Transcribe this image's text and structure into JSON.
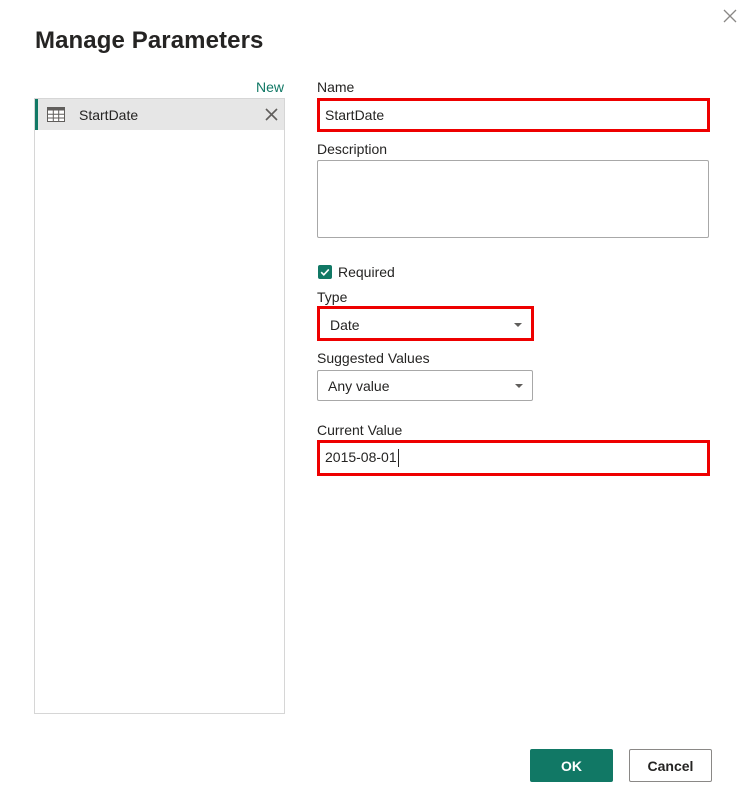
{
  "dialog": {
    "title": "Manage Parameters"
  },
  "list": {
    "new_label": "New",
    "items": [
      {
        "label": "StartDate",
        "selected": true
      }
    ]
  },
  "form": {
    "name_label": "Name",
    "name_value": "StartDate",
    "description_label": "Description",
    "description_value": "",
    "required_label": "Required",
    "required_checked": true,
    "type_label": "Type",
    "type_value": "Date",
    "suggested_label": "Suggested Values",
    "suggested_value": "Any value",
    "current_label": "Current Value",
    "current_value": "2015-08-01"
  },
  "buttons": {
    "ok": "OK",
    "cancel": "Cancel"
  },
  "colors": {
    "accent": "#117865",
    "highlight": "#ee0000"
  }
}
